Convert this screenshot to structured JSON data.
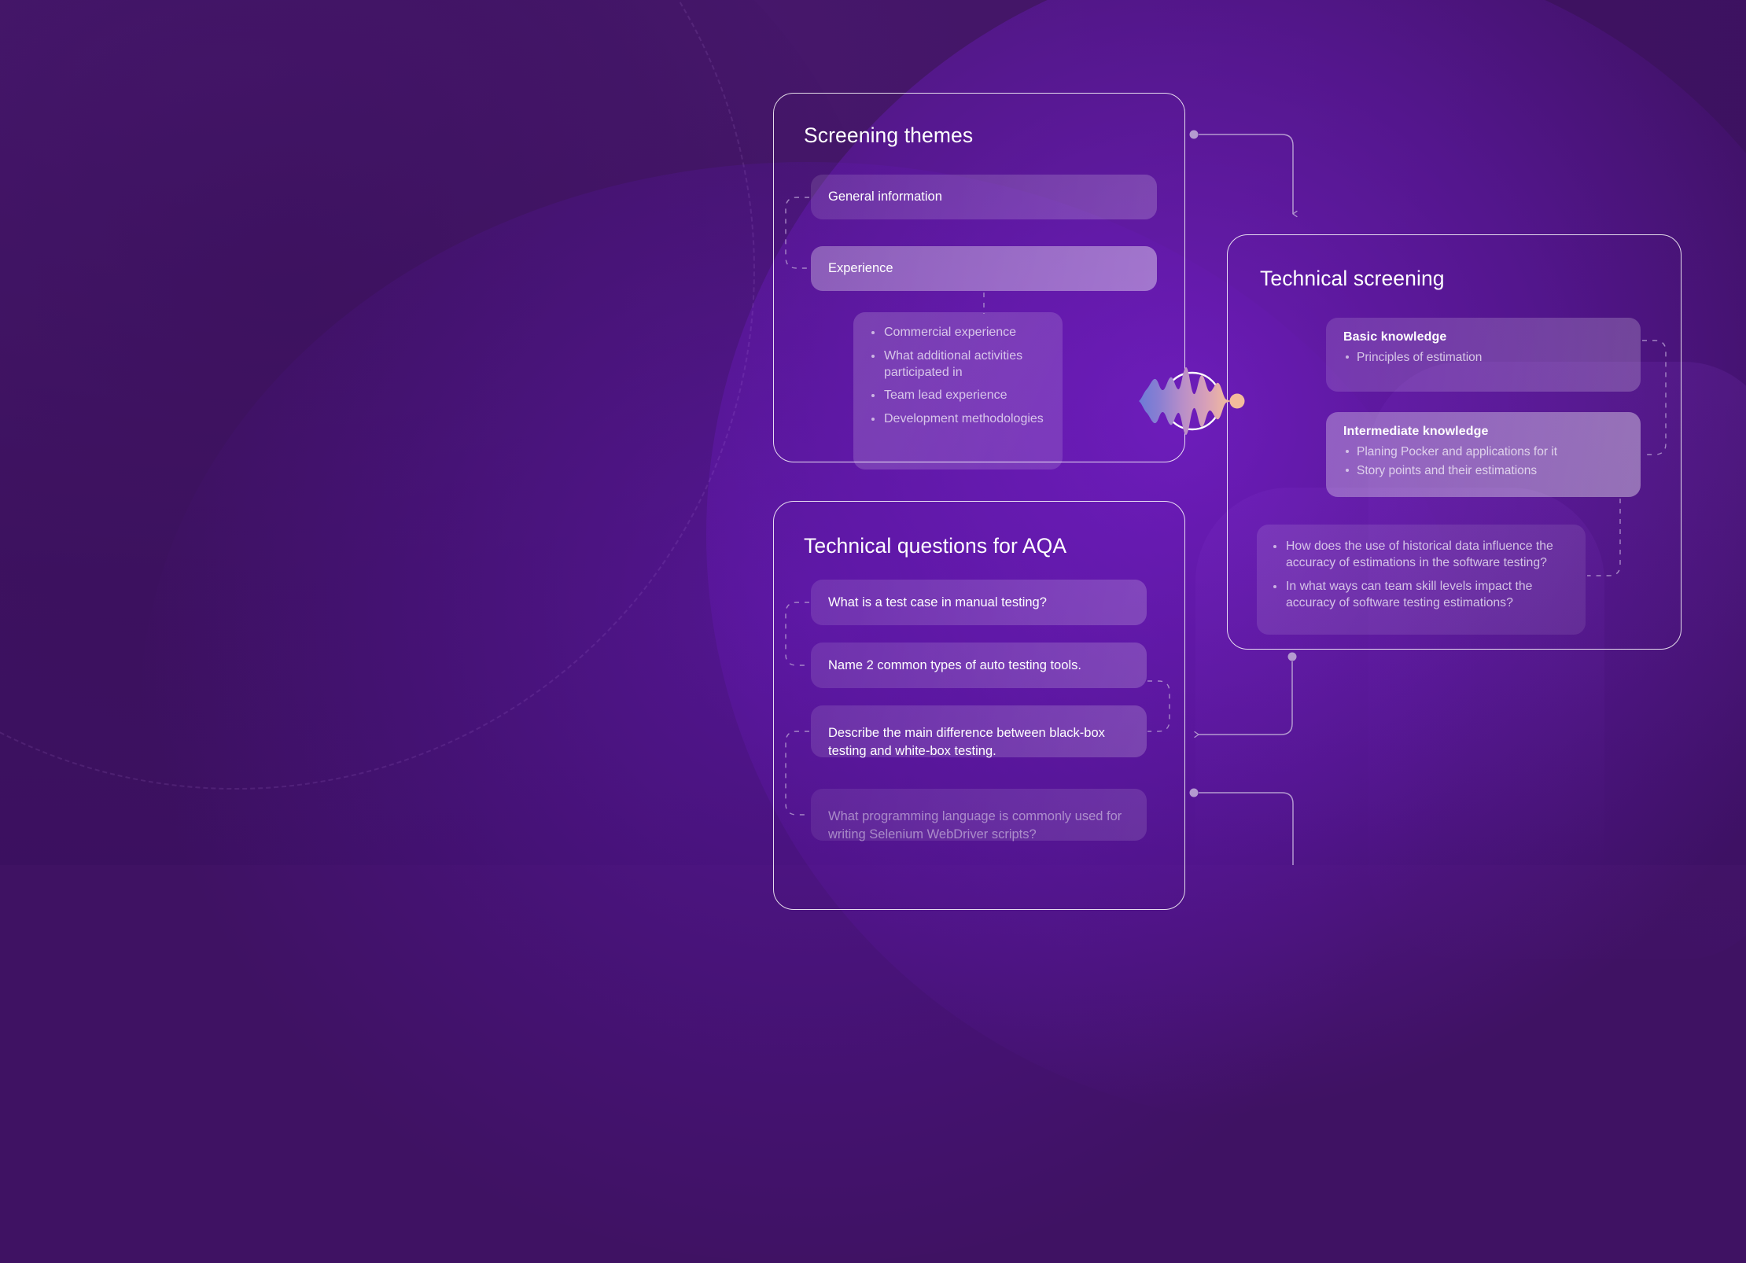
{
  "theme": {
    "bg_dark": "#3f1263",
    "bg_accent": "#5c18b4",
    "card_border": "#ffffff",
    "text_primary": "#ffffff",
    "text_muted": "rgba(255,255,255,0.70)",
    "connector": "#b49ad0"
  },
  "cards": {
    "screening": {
      "title": "Screening themes",
      "items": [
        {
          "label": "General information",
          "state": "soft"
        },
        {
          "label": "Experience",
          "state": "bright"
        }
      ],
      "experience_details": [
        "Commercial experience",
        "What additional activities participated in",
        "Team lead experience",
        "Development methodologies"
      ]
    },
    "technical": {
      "title": "Technical screening",
      "blocks": [
        {
          "heading": "Basic knowledge",
          "state": "soft",
          "items": [
            "Principles of estimation"
          ]
        },
        {
          "heading": "Intermediate knowledge",
          "state": "bright",
          "items": [
            "Planing Pocker and applications for it",
            "Story points and their estimations"
          ]
        }
      ],
      "generated_questions": [
        "How does the use of historical data influence the accuracy of estimations in the software testing?",
        "In what ways can team skill levels impact the accuracy of software testing estimations?"
      ]
    },
    "questions": {
      "title": "Technical questions for AQA",
      "items": [
        {
          "label": "What is a test case in manual testing?",
          "state": "soft"
        },
        {
          "label": "Name 2 common types of auto testing tools.",
          "state": "soft"
        },
        {
          "label": "Describe the main difference between black-box testing and white-box testing.",
          "state": "soft"
        },
        {
          "label": "What programming language is commonly used for writing Selenium WebDriver scripts?",
          "state": "ghost"
        }
      ]
    }
  },
  "hub": {
    "icon": "audio-waveform-icon",
    "gradient_start": "#6f7fd6",
    "gradient_mid": "#c58fc6",
    "gradient_end": "#f2bb9b"
  }
}
